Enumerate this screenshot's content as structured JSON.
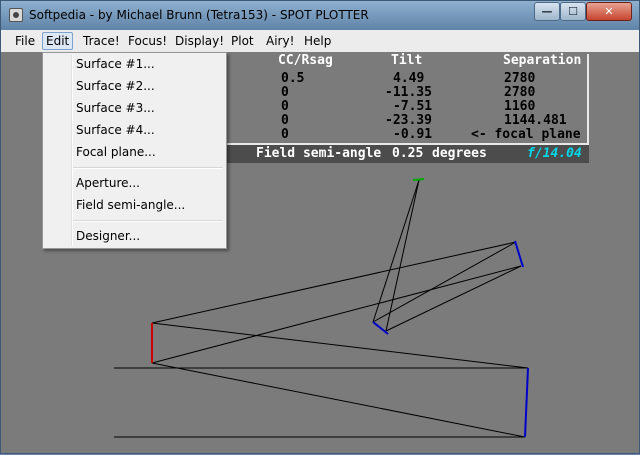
{
  "window": {
    "title": "Softpedia - by Michael Brunn (Tetra153) - SPOT PLOTTER"
  },
  "titlebar_buttons": {
    "minimize": "—",
    "maximize": "☐",
    "close": "✕"
  },
  "menubar": {
    "items": [
      "File",
      "Edit",
      "Trace!",
      "Focus!",
      "Display!",
      "Plot",
      "Airy!",
      "Help"
    ],
    "active": "Edit"
  },
  "edit_menu": {
    "items": [
      "Surface #1...",
      "Surface #2...",
      "Surface #3...",
      "Surface #4...",
      "Focal plane...",
      "Aperture...",
      "Field semi-angle...",
      "Designer..."
    ]
  },
  "table": {
    "headers": [
      "CC/Rsag",
      "Tilt",
      "Separation"
    ],
    "rows": [
      [
        "0.5",
        "4.49",
        "2780"
      ],
      [
        "0",
        "-11.35",
        "2780"
      ],
      [
        "0",
        "-7.51",
        "1160"
      ],
      [
        "0",
        "-23.39",
        "1144.481"
      ],
      [
        "0",
        "-0.91",
        "<- focal plane"
      ]
    ]
  },
  "footer": {
    "label": "Field semi-angle",
    "value": "0.25",
    "unit": "degrees",
    "fnumber": "f/14.04"
  },
  "colors": {
    "surface1": "#0000cc",
    "surface2": "#cc0000",
    "surface3": "#0000cc",
    "surface4": "#0000cc",
    "focal_plane": "#00aa00",
    "fnumber_text": "#00d8e8"
  }
}
